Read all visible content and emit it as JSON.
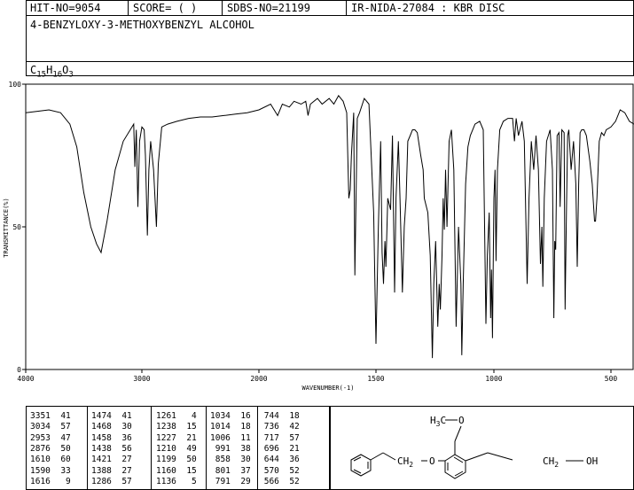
{
  "header": {
    "hit_no": "HIT-NO=9054",
    "score": "SCORE=  (  )",
    "sdbs_no": "SDBS-NO=21199",
    "ir_nida": "IR-NIDA-27084 : KBR DISC",
    "compound_name": "4-BENZYLOXY-3-METHOXYBENZYL ALCOHOL",
    "formula": {
      "c": "C",
      "c_n": "15",
      "h": "H",
      "h_n": "16",
      "o": "O",
      "o_n": "3"
    }
  },
  "chart_data": {
    "type": "line",
    "title": "",
    "xlabel": "WAVENUMBER(-1)",
    "ylabel": "TRANSMITTANCE(%)",
    "xlim": [
      4000,
      400
    ],
    "ylim": [
      0,
      100
    ],
    "x_ticks": [
      4000,
      3000,
      2000,
      1500,
      1000,
      500
    ],
    "y_ticks": [
      0,
      50,
      100
    ],
    "grid": false,
    "series": [
      {
        "values": [
          [
            4000,
            90
          ],
          [
            3900,
            90.5
          ],
          [
            3800,
            91
          ],
          [
            3700,
            90
          ],
          [
            3620,
            86
          ],
          [
            3560,
            78
          ],
          [
            3500,
            62
          ],
          [
            3440,
            50
          ],
          [
            3390,
            44
          ],
          [
            3351,
            41
          ],
          [
            3300,
            52
          ],
          [
            3230,
            70
          ],
          [
            3160,
            80
          ],
          [
            3100,
            84
          ],
          [
            3070,
            86
          ],
          [
            3060,
            71
          ],
          [
            3048,
            84
          ],
          [
            3034,
            57
          ],
          [
            3020,
            80
          ],
          [
            3000,
            85
          ],
          [
            2980,
            84
          ],
          [
            2970,
            75
          ],
          [
            2953,
            47
          ],
          [
            2940,
            70
          ],
          [
            2925,
            80
          ],
          [
            2900,
            70
          ],
          [
            2876,
            50
          ],
          [
            2860,
            72
          ],
          [
            2830,
            85
          ],
          [
            2780,
            86
          ],
          [
            2700,
            87
          ],
          [
            2600,
            88
          ],
          [
            2500,
            88.5
          ],
          [
            2400,
            88.5
          ],
          [
            2300,
            89
          ],
          [
            2200,
            89.5
          ],
          [
            2100,
            90
          ],
          [
            2000,
            91
          ],
          [
            1950,
            93
          ],
          [
            1920,
            89
          ],
          [
            1900,
            93
          ],
          [
            1870,
            92
          ],
          [
            1850,
            94
          ],
          [
            1820,
            93
          ],
          [
            1800,
            94
          ],
          [
            1790,
            89
          ],
          [
            1780,
            93
          ],
          [
            1750,
            95
          ],
          [
            1730,
            93
          ],
          [
            1700,
            95
          ],
          [
            1680,
            93
          ],
          [
            1660,
            96
          ],
          [
            1640,
            94
          ],
          [
            1625,
            90
          ],
          [
            1616,
            60
          ],
          [
            1610,
            63
          ],
          [
            1605,
            75
          ],
          [
            1595,
            90
          ],
          [
            1590,
            33
          ],
          [
            1580,
            88
          ],
          [
            1570,
            90
          ],
          [
            1550,
            95
          ],
          [
            1530,
            93
          ],
          [
            1510,
            55
          ],
          [
            1500,
            9
          ],
          [
            1490,
            50
          ],
          [
            1480,
            80
          ],
          [
            1474,
            41
          ],
          [
            1468,
            30
          ],
          [
            1462,
            45
          ],
          [
            1458,
            36
          ],
          [
            1450,
            60
          ],
          [
            1438,
            56
          ],
          [
            1430,
            82
          ],
          [
            1421,
            27
          ],
          [
            1415,
            60
          ],
          [
            1405,
            80
          ],
          [
            1398,
            60
          ],
          [
            1388,
            27
          ],
          [
            1380,
            50
          ],
          [
            1372,
            60
          ],
          [
            1365,
            80
          ],
          [
            1355,
            82
          ],
          [
            1345,
            84
          ],
          [
            1335,
            84
          ],
          [
            1325,
            83
          ],
          [
            1310,
            75
          ],
          [
            1300,
            70
          ],
          [
            1295,
            60
          ],
          [
            1286,
            57
          ],
          [
            1280,
            55
          ],
          [
            1270,
            40
          ],
          [
            1261,
            4
          ],
          [
            1255,
            30
          ],
          [
            1247,
            45
          ],
          [
            1238,
            15
          ],
          [
            1232,
            30
          ],
          [
            1227,
            21
          ],
          [
            1220,
            40
          ],
          [
            1215,
            60
          ],
          [
            1210,
            49
          ],
          [
            1205,
            70
          ],
          [
            1199,
            50
          ],
          [
            1190,
            80
          ],
          [
            1180,
            84
          ],
          [
            1170,
            70
          ],
          [
            1160,
            15
          ],
          [
            1150,
            50
          ],
          [
            1140,
            30
          ],
          [
            1136,
            5
          ],
          [
            1130,
            30
          ],
          [
            1120,
            65
          ],
          [
            1110,
            78
          ],
          [
            1100,
            82
          ],
          [
            1080,
            86
          ],
          [
            1060,
            87
          ],
          [
            1045,
            84
          ],
          [
            1034,
            16
          ],
          [
            1028,
            40
          ],
          [
            1020,
            55
          ],
          [
            1014,
            18
          ],
          [
            1010,
            35
          ],
          [
            1006,
            11
          ],
          [
            1000,
            60
          ],
          [
            995,
            70
          ],
          [
            991,
            38
          ],
          [
            985,
            70
          ],
          [
            975,
            84
          ],
          [
            960,
            87
          ],
          [
            940,
            88
          ],
          [
            920,
            88
          ],
          [
            912,
            80
          ],
          [
            905,
            88
          ],
          [
            895,
            82
          ],
          [
            880,
            87
          ],
          [
            870,
            80
          ],
          [
            858,
            30
          ],
          [
            850,
            60
          ],
          [
            840,
            80
          ],
          [
            830,
            70
          ],
          [
            820,
            82
          ],
          [
            810,
            70
          ],
          [
            801,
            37
          ],
          [
            795,
            50
          ],
          [
            791,
            29
          ],
          [
            785,
            60
          ],
          [
            775,
            80
          ],
          [
            760,
            84
          ],
          [
            750,
            70
          ],
          [
            744,
            18
          ],
          [
            740,
            45
          ],
          [
            736,
            42
          ],
          [
            730,
            82
          ],
          [
            722,
            83
          ],
          [
            717,
            57
          ],
          [
            710,
            84
          ],
          [
            700,
            83
          ],
          [
            696,
            21
          ],
          [
            690,
            55
          ],
          [
            685,
            82
          ],
          [
            680,
            84
          ],
          [
            670,
            70
          ],
          [
            660,
            80
          ],
          [
            650,
            65
          ],
          [
            644,
            36
          ],
          [
            638,
            65
          ],
          [
            632,
            83
          ],
          [
            625,
            84
          ],
          [
            615,
            84
          ],
          [
            605,
            82
          ],
          [
            590,
            73
          ],
          [
            580,
            65
          ],
          [
            570,
            52
          ],
          [
            566,
            52
          ],
          [
            560,
            60
          ],
          [
            550,
            80
          ],
          [
            540,
            83
          ],
          [
            530,
            82
          ],
          [
            520,
            84
          ],
          [
            500,
            85
          ],
          [
            480,
            87
          ],
          [
            460,
            91
          ],
          [
            440,
            90
          ],
          [
            420,
            87
          ],
          [
            400,
            86
          ]
        ]
      }
    ]
  },
  "peak_table": [
    [
      [
        3351,
        41
      ],
      [
        3034,
        57
      ],
      [
        2953,
        47
      ],
      [
        2876,
        50
      ],
      [
        1610,
        60
      ],
      [
        1590,
        33
      ],
      [
        1616,
        9
      ]
    ],
    [
      [
        1474,
        41
      ],
      [
        1468,
        30
      ],
      [
        1458,
        36
      ],
      [
        1438,
        56
      ],
      [
        1421,
        27
      ],
      [
        1388,
        27
      ],
      [
        1286,
        57
      ]
    ],
    [
      [
        1261,
        4
      ],
      [
        1238,
        15
      ],
      [
        1227,
        21
      ],
      [
        1210,
        49
      ],
      [
        1199,
        50
      ],
      [
        1160,
        15
      ],
      [
        1136,
        5
      ]
    ],
    [
      [
        1034,
        16
      ],
      [
        1014,
        18
      ],
      [
        1006,
        11
      ],
      [
        991,
        38
      ],
      [
        858,
        30
      ],
      [
        801,
        37
      ],
      [
        791,
        29
      ]
    ],
    [
      [
        744,
        18
      ],
      [
        736,
        42
      ],
      [
        717,
        57
      ],
      [
        696,
        21
      ],
      [
        644,
        36
      ],
      [
        570,
        52
      ],
      [
        566,
        52
      ]
    ]
  ],
  "structure": {
    "methoxy_h": "H",
    "methoxy_3": "3",
    "methoxy_co": "C",
    "ring_o": "O",
    "ch2_left": "CH",
    "ch2_left_sub": "2",
    "ether_o": "O",
    "ch2oh": "CH",
    "ch2oh_sub": "2",
    "oh": "OH"
  }
}
